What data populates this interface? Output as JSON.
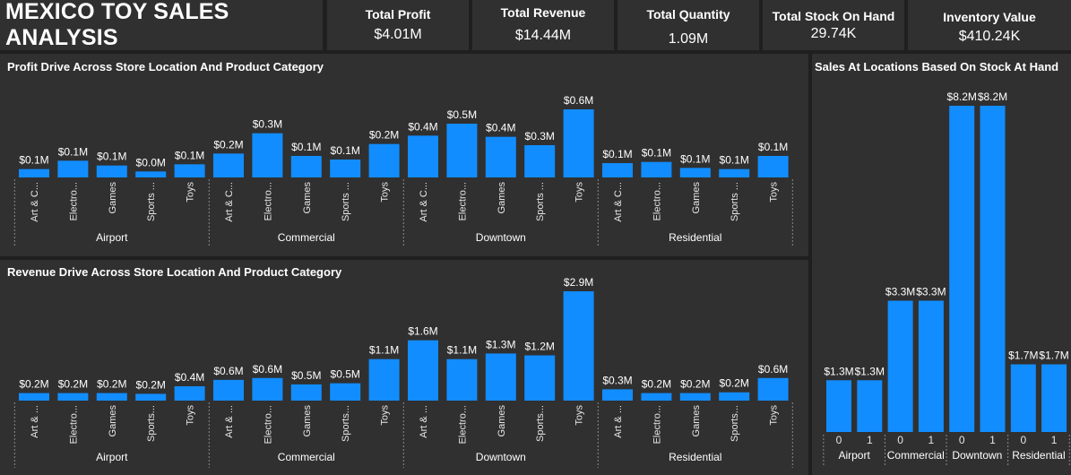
{
  "header": {
    "title": "MEXICO TOY SALES ANALYSIS",
    "kpis": [
      {
        "label": "Total Profit",
        "value": "$4.01M"
      },
      {
        "label": "Total Revenue",
        "value": "$14.44M"
      },
      {
        "label": "Total Quantity",
        "value": "1.09M"
      },
      {
        "label": "Total Stock On Hand",
        "value": "29.74K"
      },
      {
        "label": "Inventory Value",
        "value": "$410.24K"
      }
    ]
  },
  "colors": {
    "bar": "#118dff",
    "background": "#303030",
    "page": "#1f1f1f"
  },
  "chart_data": [
    {
      "type": "bar",
      "title": "Profit Drive Across Store Location And Product Category",
      "groups": [
        "Airport",
        "Commercial",
        "Downtown",
        "Residential"
      ],
      "categories": [
        "Art & C...",
        "Electro...",
        "Games",
        "Sports ...",
        "Toys"
      ],
      "series": [
        {
          "values": [
            [
              0.07,
              0.14,
              0.1,
              0.05,
              0.11
            ],
            [
              0.2,
              0.37,
              0.18,
              0.15,
              0.28
            ],
            [
              0.35,
              0.45,
              0.34,
              0.27,
              0.57
            ],
            [
              0.12,
              0.13,
              0.08,
              0.07,
              0.18
            ]
          ],
          "labels": [
            [
              "$0.1M",
              "$0.1M",
              "$0.1M",
              "$0.0M",
              "$0.1M"
            ],
            [
              "$0.2M",
              "$0.3M",
              "$0.1M",
              "$0.1M",
              "$0.2M"
            ],
            [
              "$0.4M",
              "$0.5M",
              "$0.4M",
              "$0.3M",
              "$0.6M"
            ],
            [
              "$0.1M",
              "$0.1M",
              "$0.1M",
              "$0.1M",
              "$0.1M"
            ]
          ]
        }
      ]
    },
    {
      "type": "bar",
      "title": "Revenue Drive Across Store Location And Product Category",
      "groups": [
        "Airport",
        "Commercial",
        "Downtown",
        "Residential"
      ],
      "categories": [
        "Art & ...",
        "Electro...",
        "Games",
        "Sports...",
        "Toys"
      ],
      "series": [
        {
          "values": [
            [
              0.2,
              0.2,
              0.2,
              0.18,
              0.38
            ],
            [
              0.55,
              0.6,
              0.43,
              0.46,
              1.1
            ],
            [
              1.6,
              1.1,
              1.25,
              1.2,
              2.9
            ],
            [
              0.3,
              0.2,
              0.2,
              0.22,
              0.6
            ]
          ],
          "labels": [
            [
              "$0.2M",
              "$0.2M",
              "$0.2M",
              "$0.2M",
              "$0.4M"
            ],
            [
              "$0.6M",
              "$0.6M",
              "$0.5M",
              "$0.5M",
              "$1.1M"
            ],
            [
              "$1.6M",
              "$1.1M",
              "$1.3M",
              "$1.2M",
              "$2.9M"
            ],
            [
              "$0.3M",
              "$0.2M",
              "$0.2M",
              "$0.2M",
              "$0.6M"
            ]
          ]
        }
      ]
    },
    {
      "type": "bar",
      "title": "Sales At Locations Based On Stock At Hand",
      "groups": [
        "Airport",
        "Commercial",
        "Downtown",
        "Residential"
      ],
      "categories": [
        "0",
        "1"
      ],
      "series": [
        {
          "values": [
            [
              1.3,
              1.3
            ],
            [
              3.3,
              3.3
            ],
            [
              8.2,
              8.2
            ],
            [
              1.7,
              1.7
            ]
          ],
          "labels": [
            [
              "$1.3M",
              "$1.3M"
            ],
            [
              "$3.3M",
              "$3.3M"
            ],
            [
              "$8.2M",
              "$8.2M"
            ],
            [
              "$1.7M",
              "$1.7M"
            ]
          ]
        }
      ]
    }
  ]
}
